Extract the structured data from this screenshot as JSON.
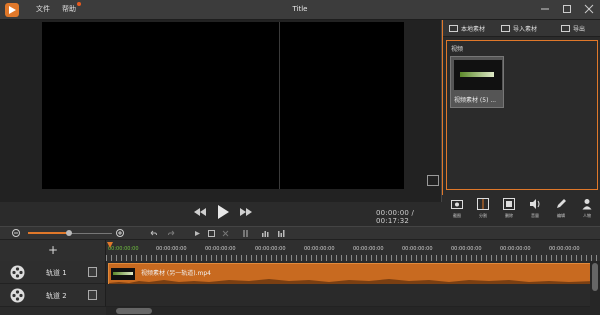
{
  "app": {
    "title": "Title",
    "menu": {
      "file": "文件",
      "help": "帮助"
    }
  },
  "player": {
    "timecode": "00:00:00 / 00:17:32"
  },
  "panel": {
    "tabs": [
      {
        "label": "本地素材",
        "icon": "film-icon"
      },
      {
        "label": "导入素材",
        "icon": "folder-icon"
      },
      {
        "label": "导出",
        "icon": "export-icon"
      }
    ],
    "section_label": "视频",
    "media_items": [
      {
        "name": "视频素材 (5) ..."
      }
    ]
  },
  "tools": [
    {
      "label": "截图",
      "icon": "camera-icon"
    },
    {
      "label": "分割",
      "icon": "split-icon"
    },
    {
      "label": "删除",
      "icon": "trash-icon"
    },
    {
      "label": "音量",
      "icon": "speaker-icon"
    },
    {
      "label": "编辑",
      "icon": "pen-icon"
    },
    {
      "label": "人物",
      "icon": "person-icon"
    }
  ],
  "timeline": {
    "ticks": [
      "00:00:00:00",
      "00:00:00:00",
      "00:00:00:00",
      "00:00:00:00",
      "00:00:00:00",
      "00:00:00:00",
      "00:00:00:00",
      "00:00:00:00",
      "00:00:00:00",
      "00:00:00:00"
    ],
    "tracks": [
      {
        "name": "轨道 1"
      },
      {
        "name": "轨道 2"
      }
    ],
    "clip_label": "视频素材 (另一轨道).mp4"
  },
  "colors": {
    "accent": "#e0782a",
    "clip": "#c86a20",
    "background": "#2b2b2b"
  }
}
